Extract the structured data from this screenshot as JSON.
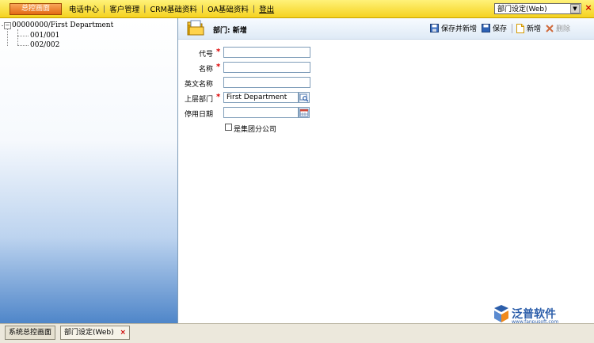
{
  "topbar": {
    "home_button": "总控画面",
    "menu": [
      "电话中心",
      "客户管理",
      "CRM基础资料",
      "OA基础资料",
      "登出"
    ],
    "module_select": "部门设定(Web)",
    "close": "×"
  },
  "tree": {
    "root": "00000000/First Department",
    "root_toggle": "−",
    "children": [
      "001/001",
      "002/002"
    ]
  },
  "form": {
    "title": "部门: 新增",
    "toolbar": {
      "save_new": "保存并新增",
      "save": "保存",
      "new": "新增",
      "delete": "删除"
    },
    "fields": {
      "code_label": "代号",
      "name_label": "名称",
      "english_name_label": "英文名称",
      "parent_label": "上层部门",
      "parent_value": "First Department",
      "disable_date_label": "停用日期",
      "group_branch_label": "是集团分公司"
    },
    "required_mark": "*"
  },
  "branding": {
    "name": "泛普软件",
    "url": "www.fanpusoft.com"
  },
  "tabs": {
    "system_home": "系统总控画面",
    "dept_setup": "部门设定(Web)",
    "close": "×"
  },
  "colors": {
    "topbar": "#f5d21f",
    "home_button": "#e36a14",
    "required": "#dd0000",
    "brand": "#2c5eaa"
  }
}
